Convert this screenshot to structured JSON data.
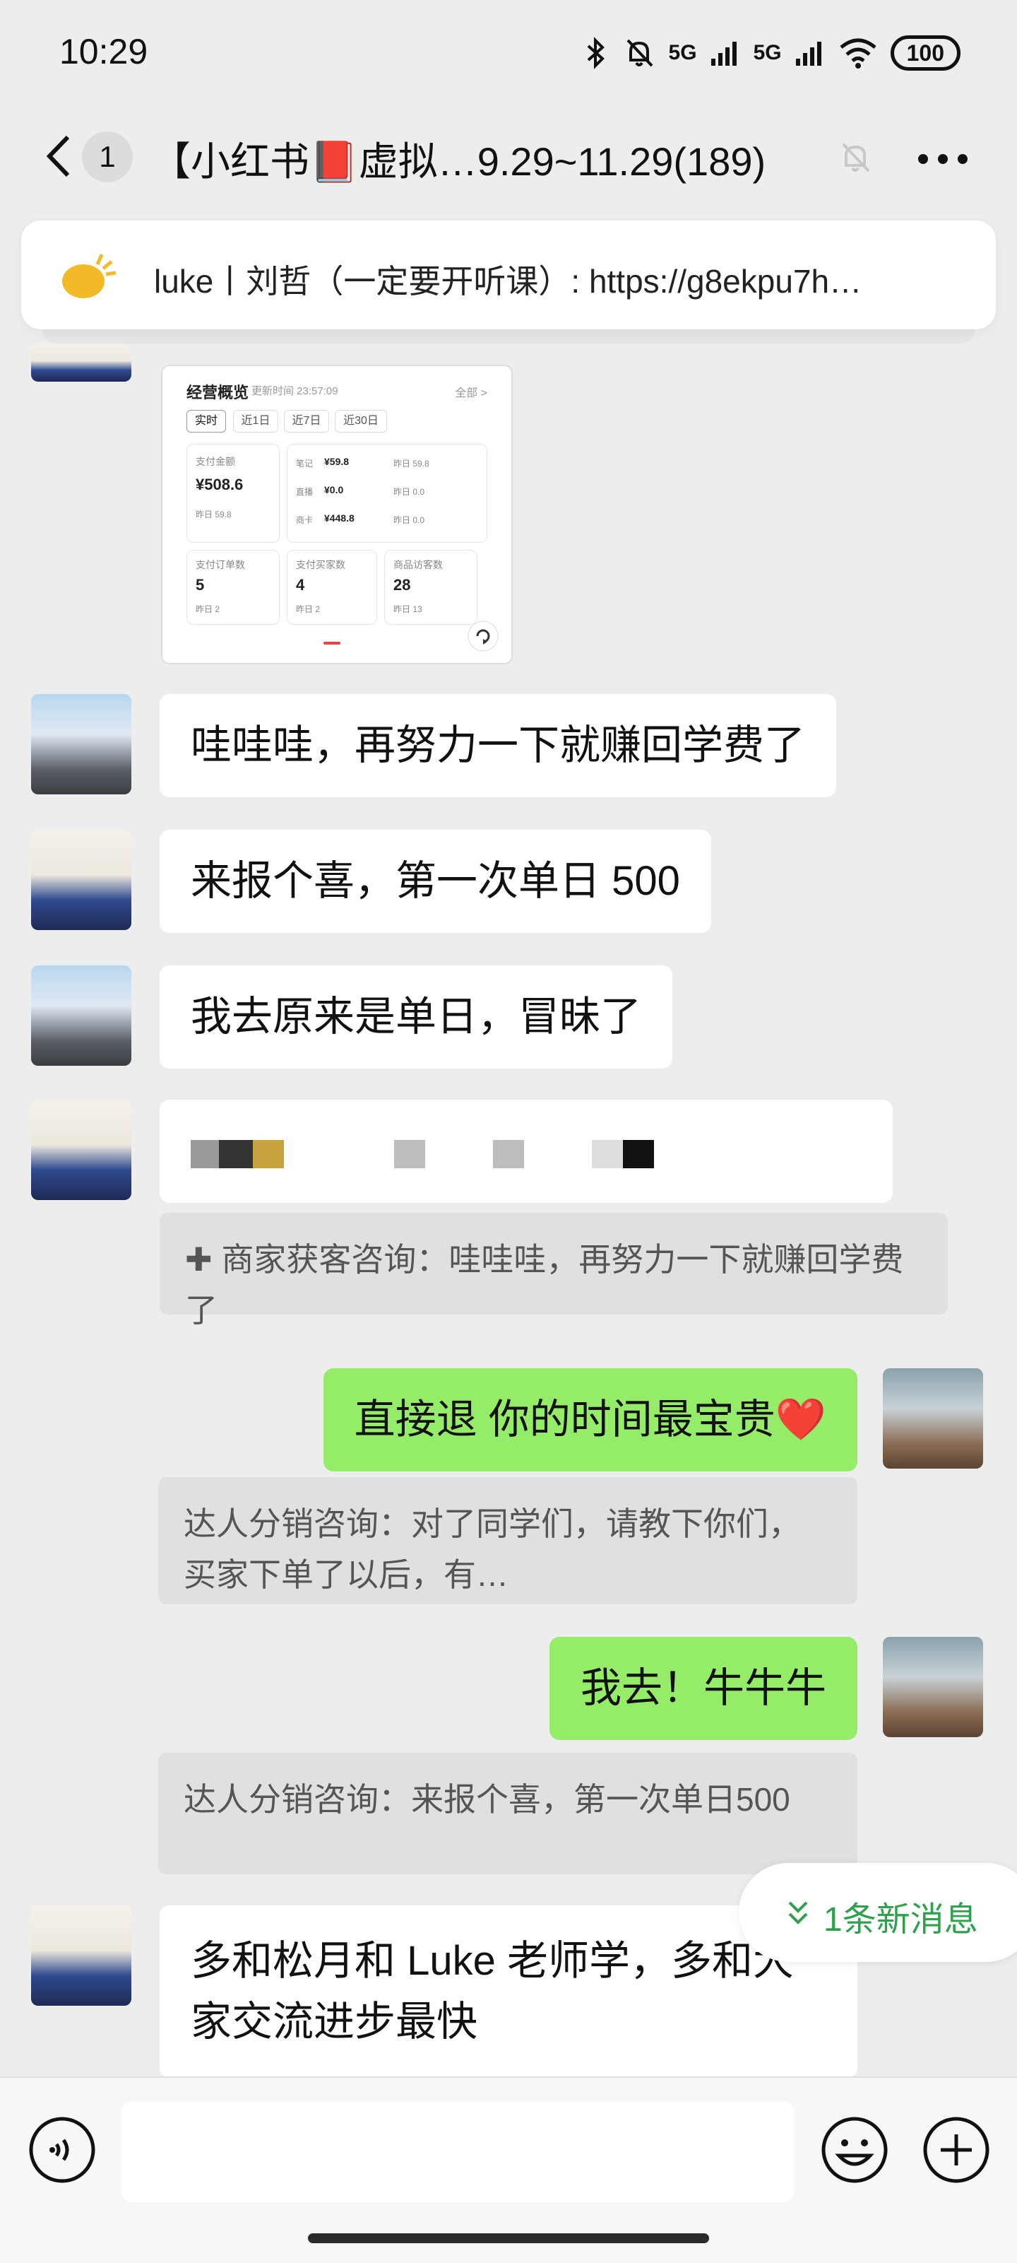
{
  "status_bar": {
    "time": "10:29",
    "network_1": "5G",
    "network_2": "5G",
    "battery": "100",
    "icons": [
      "bluetooth-icon",
      "mute-bell-icon",
      "signal-icon",
      "signal-icon",
      "wifi-icon",
      "battery-icon"
    ]
  },
  "header": {
    "back_count": "1",
    "title": "【小红书📕虚拟…9.29~11.29(189)",
    "icons": [
      "back-arrow-icon",
      "muted-bell-icon",
      "more-icon"
    ]
  },
  "pinned": {
    "text": "luke丨刘哲（一定要开听课）: https://g8ekpu7h…",
    "icon": "megaphone-icon"
  },
  "image_card": {
    "title": "经营概览",
    "subtitle": "更新时间 23:57:09",
    "all": "全部 >",
    "tabs": [
      "实时",
      "近1日",
      "近7日",
      "近30日"
    ],
    "pay_amount_label": "支付金额",
    "pay_amount": "¥508.6",
    "pay_amount_prev": "昨日 59.8",
    "note_label": "笔记",
    "note_value": "¥59.8",
    "note_prev": "昨日 59.8",
    "live_label": "直播",
    "live_value": "¥0.0",
    "live_prev": "昨日 0.0",
    "card_label": "商卡",
    "card_value": "¥448.8",
    "card_prev": "昨日 0.0",
    "orders_label": "支付订单数",
    "orders_value": "5",
    "orders_prev": "昨日 2",
    "buyers_label": "支付买家数",
    "buyers_value": "4",
    "buyers_prev": "昨日 2",
    "visitors_label": "商品访客数",
    "visitors_value": "28",
    "visitors_prev": "昨日 13"
  },
  "messages": [
    {
      "text": "哇哇哇，再努力一下就赚回学费了"
    },
    {
      "text": "来报个喜，第一次单日 500"
    },
    {
      "text": "我去原来是单日，冒昧了"
    },
    {
      "text": "",
      "quote": "✚ 商家获客咨询：哇哇哇，再努力一下就赚回学费了"
    },
    {
      "text": "直接退 你的时间最宝贵❤️",
      "quote": "达人分销咨询：对了同学们，请教下你们，买家下单了以后，有…"
    },
    {
      "text": "我去！牛牛牛",
      "quote": "达人分销咨询：来报个喜，第一次单日500"
    },
    {
      "text": "多和松月和 Luke 老师学，多和大家交流进步最快"
    }
  ],
  "new_message_pill": "1条新消息",
  "input_bar": {
    "icons": [
      "voice-icon",
      "emoji-icon",
      "plus-icon"
    ]
  }
}
